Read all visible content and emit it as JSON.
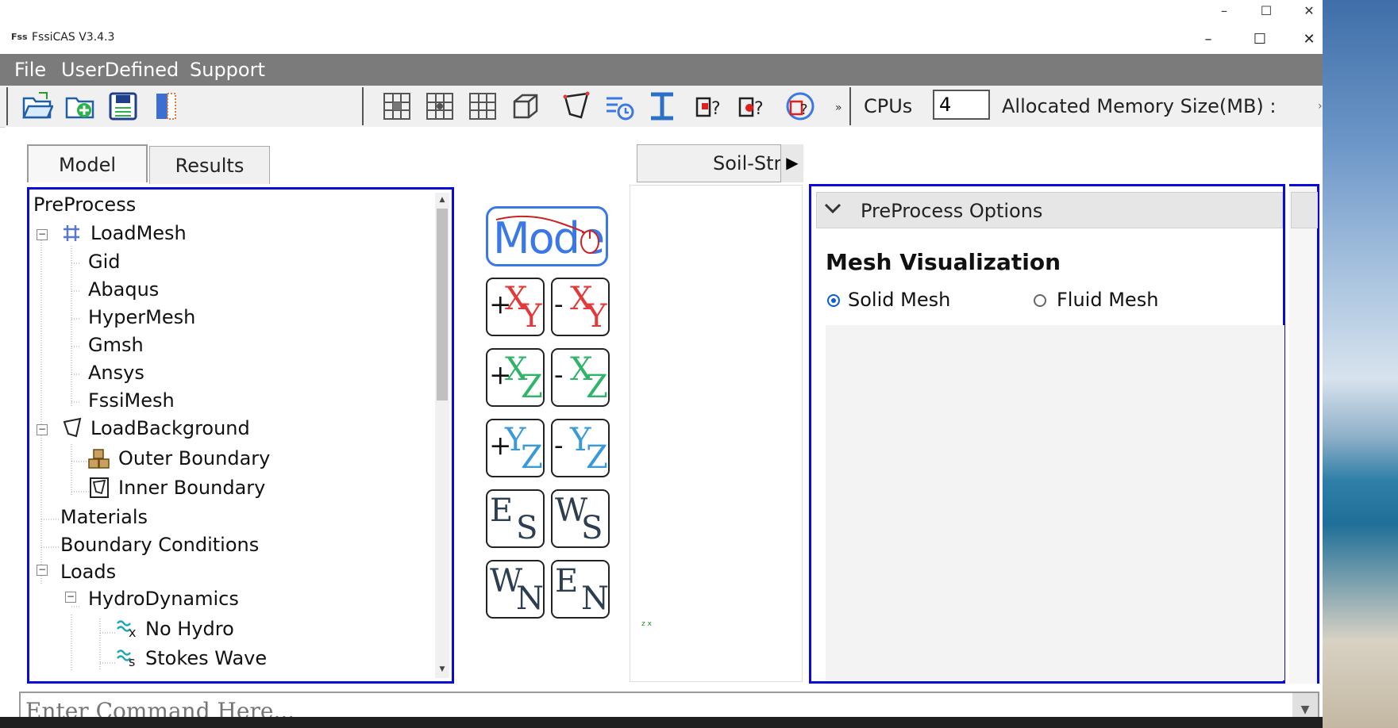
{
  "window": {
    "title": "FssiCAS V3.4.3",
    "icon_text": "Fss",
    "outer_controls": {
      "minimize": "–",
      "maximize": "☐",
      "close": "✕"
    },
    "controls": {
      "minimize": "–",
      "maximize": "☐",
      "close": "✕"
    }
  },
  "menu": {
    "items": [
      "File",
      "UserDefined",
      "Support"
    ]
  },
  "toolbar": {
    "file_icons": [
      "open-folder-icon",
      "add-folder-icon",
      "save-icon",
      "book-icon"
    ],
    "view_icons": [
      "grid-center-icon",
      "grid-dot-icon",
      "grid-icon",
      "cube-icon",
      "polygon-icon",
      "timer-list-icon",
      "i-beam-icon",
      "query-red-icon",
      "query-dot-icon",
      "query-globe-icon"
    ],
    "overflow": "»",
    "cpus_label": "CPUs",
    "cpus_value": "4",
    "memory_label": "Allocated Memory Size(MB) :",
    "end_chevron": "›"
  },
  "left_tabs": {
    "model": "Model",
    "results": "Results"
  },
  "tree": {
    "root": "PreProcess",
    "load_mesh": "LoadMesh",
    "mesh_items": [
      "Gid",
      "Abaqus",
      "HyperMesh",
      "Gmsh",
      "Ansys",
      "FssiMesh"
    ],
    "load_background": "LoadBackground",
    "outer_boundary": "Outer Boundary",
    "inner_boundary": "Inner Boundary",
    "materials": "Materials",
    "boundary_conditions": "Boundary Conditions",
    "loads": "Loads",
    "hydrodynamics": "HydroDynamics",
    "no_hydro": "No Hydro",
    "stokes_wave": "Stokes Wave",
    "expander": "−"
  },
  "view_panel": {
    "mode_label": "Mode",
    "buttons": [
      {
        "sign": "+",
        "a": "X",
        "b": "Y",
        "color": "#e03a3a"
      },
      {
        "sign": "-",
        "a": "X",
        "b": "Y",
        "color": "#e03a3a"
      },
      {
        "sign": "+",
        "a": "X",
        "b": "Z",
        "color": "#2fb46a"
      },
      {
        "sign": "-",
        "a": "X",
        "b": "Z",
        "color": "#2fb46a"
      },
      {
        "sign": "+",
        "a": "Y",
        "b": "Z",
        "color": "#3a9ad8"
      },
      {
        "sign": "-",
        "a": "Y",
        "b": "Z",
        "color": "#3a9ad8"
      },
      {
        "sign": "",
        "a": "E",
        "b": "S",
        "color": "#2c3e50"
      },
      {
        "sign": "",
        "a": "W",
        "b": "S",
        "color": "#2c3e50"
      },
      {
        "sign": "",
        "a": "W",
        "b": "N",
        "color": "#2c3e50"
      },
      {
        "sign": "",
        "a": "E",
        "b": "N",
        "color": "#2c3e50"
      }
    ]
  },
  "viewport": {
    "tab_label": "Soil-Structure",
    "axes": "z x",
    "scroll_right": "▶"
  },
  "preprocess_options": {
    "header": "PreProcess Options",
    "section_title": "Mesh Visualization",
    "radios": [
      {
        "label": "Solid Mesh",
        "selected": true
      },
      {
        "label": "Fluid Mesh",
        "selected": false
      }
    ]
  },
  "command": {
    "placeholder": "Enter Command Here...",
    "dropdown": "▼"
  },
  "colors": {
    "accent_blue": "#0b0bd8",
    "menu_gray": "#7b7b7b",
    "mode_blue": "#3b78e7"
  }
}
